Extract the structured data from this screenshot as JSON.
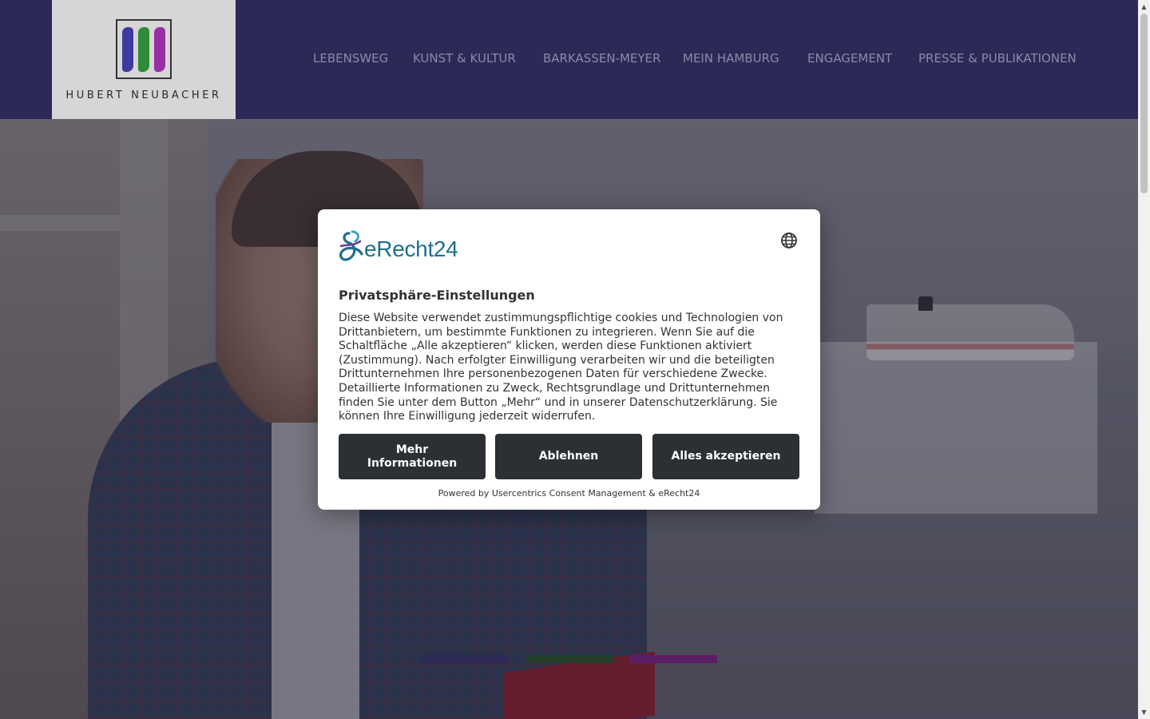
{
  "header": {
    "logo_text": "HUBERT NEUBACHER",
    "nav": [
      {
        "label": "LEBENSWEG"
      },
      {
        "label": "KUNST & KULTUR"
      },
      {
        "label": "BARKASSEN-MEYER"
      },
      {
        "label": "MEIN HAMBURG"
      },
      {
        "label": "ENGAGEMENT"
      },
      {
        "label": "PRESSE & PUBLIKATIONEN"
      }
    ]
  },
  "consent": {
    "brand_name": "eRecht24",
    "language_icon": "globe-icon",
    "title": "Privatsphäre-Einstellungen",
    "body": "Diese Website verwendet zustimmungspflichtige cookies und Technologien von Drittanbietern, um bestimmte Funktionen zu integrieren. Wenn Sie auf die Schaltfläche „Alle akzeptieren“ klicken, werden diese Funktionen aktiviert (Zustimmung). Nach erfolgter Einwilligung verarbeiten wir und die beteiligten Drittunternehmen Ihre personenbezogenen Daten für verschiedene Zwecke. Detaillierte Informationen zu Zweck, Rechtsgrundlage und Drittunternehmen finden Sie unter dem Button „Mehr“ und in unserer Datenschutzerklärung. Sie können Ihre Einwilligung jederzeit widerrufen.",
    "buttons": {
      "more": "Mehr Informationen",
      "deny": "Ablehnen",
      "accept": "Alles akzeptieren"
    },
    "powered_by": "Powered by Usercentrics Consent Management & eRecht24"
  },
  "colors": {
    "header_bg": "#2c2858",
    "brand_teal": "#1d6f8f",
    "button_bg": "#2c2f34",
    "bar_purple_dark": "#2c2858",
    "bar_green": "#24402a",
    "bar_purple": "#5a1f66"
  }
}
